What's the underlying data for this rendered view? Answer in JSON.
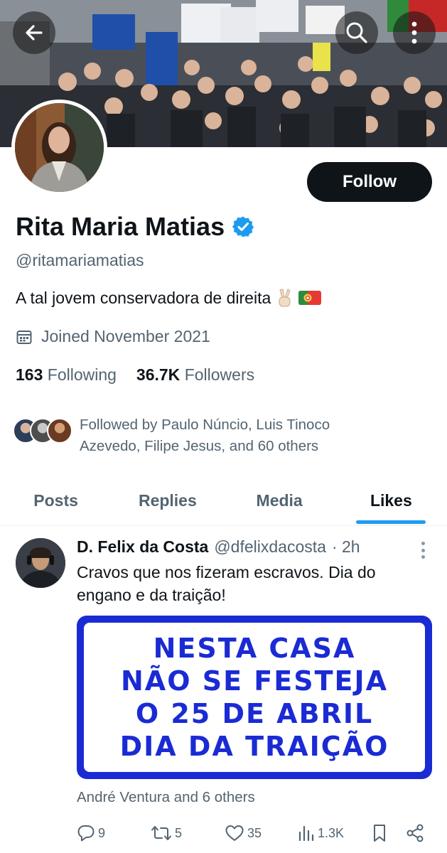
{
  "profile": {
    "name": "Rita Maria Matias",
    "handle": "@ritamariamatias",
    "bio": "A tal jovem conservadora de direita",
    "bio_emojis": [
      "victory-hand-emoji",
      "portugal-flag-emoji"
    ],
    "joined": "Joined November 2021",
    "following_count": "163",
    "following_label": "Following",
    "followers_count": "36.7K",
    "followers_label": "Followers",
    "followed_by": "Followed by Paulo Núncio, Luis Tinoco Azevedo, Filipe Jesus, and 60 others",
    "follow_label": "Follow",
    "verified": true
  },
  "tabs": [
    {
      "label": "Posts",
      "active": false
    },
    {
      "label": "Replies",
      "active": false
    },
    {
      "label": "Media",
      "active": false
    },
    {
      "label": "Likes",
      "active": true
    }
  ],
  "tweet": {
    "author": "D. Felix da Costa",
    "handle": "@dfelixdacosta",
    "time": "· 2h",
    "text": "Cravos que nos fizeram escravos. Dia do engano e da traição!",
    "image_lines": [
      "NESTA CASA",
      "NÃO SE FESTEJA",
      "O 25 DE ABRIL",
      "DIA DA TRAIÇÃO"
    ],
    "liked_by": "André Ventura and 6 others",
    "replies": "9",
    "reposts": "5",
    "likes": "35",
    "views": "1.3K"
  },
  "colors": {
    "accent": "#1d9bf0",
    "text": "#0f1419",
    "secondary": "#536471",
    "sign_blue": "#1a2bd4"
  }
}
